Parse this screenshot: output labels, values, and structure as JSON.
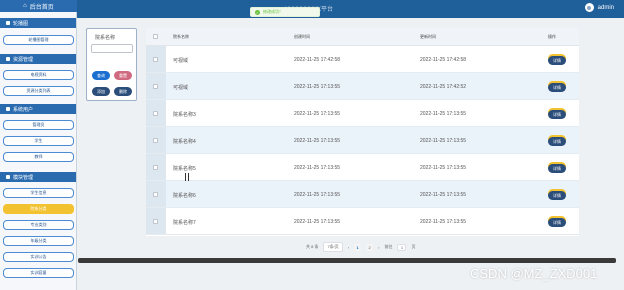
{
  "header": {
    "home_label": "后台首页",
    "title": "XXXXXXXXX平台",
    "user": "admin",
    "toast": "修改成功！"
  },
  "sidebar": {
    "groups": [
      {
        "title": "轮播图",
        "items": [
          "轮播图管理"
        ]
      },
      {
        "title": "资源管理",
        "items": [
          "电视资料",
          "资源分类列表"
        ]
      },
      {
        "title": "系统用户",
        "items": [
          "管理员",
          "学生",
          "教师"
        ]
      },
      {
        "title": "模块管理",
        "items": [
          "学生信息",
          "院系分类",
          "专业类别",
          "年级分类",
          "实训公告",
          "实训容量"
        ]
      }
    ]
  },
  "filter": {
    "label": "院系名称",
    "input_value": "",
    "buttons": {
      "search": "查询",
      "reset": "重置",
      "add": "添加",
      "delete": "删除"
    }
  },
  "table": {
    "headers": [
      "院系名称",
      "创建时间",
      "更新时间",
      "操作"
    ],
    "rows": [
      {
        "name": "可视域",
        "created": "2022-11-25 17:42:58",
        "updated": "2022-11-25 17:42:58",
        "action": "详情"
      },
      {
        "name": "可视域",
        "created": "2022-11-25 17:13:55",
        "updated": "2022-11-25 17:42:52",
        "action": "详情"
      },
      {
        "name": "院系名称3",
        "created": "2022-11-25 17:13:55",
        "updated": "2022-11-25 17:13:55",
        "action": "详情"
      },
      {
        "name": "院系名称4",
        "created": "2022-11-25 17:13:55",
        "updated": "2022-11-25 17:13:55",
        "action": "详情"
      },
      {
        "name": "院系名称5",
        "created": "2022-11-25 17:13:55",
        "updated": "2022-11-25 17:13:55",
        "action": "详情"
      },
      {
        "name": "院系名称6",
        "created": "2022-11-25 17:13:55",
        "updated": "2022-11-25 17:13:55",
        "action": "详情"
      },
      {
        "name": "院系名称7",
        "created": "2022-11-25 17:13:55",
        "updated": "2022-11-25 17:13:55",
        "action": "详情"
      }
    ]
  },
  "pager": {
    "total": "共 8 条",
    "page_size": "7条/页",
    "prev": "‹",
    "pages": [
      "1",
      "2"
    ],
    "next": "›",
    "goto_label": "前往",
    "goto_value": "1",
    "goto_suffix": "页"
  },
  "watermark": "CSDN @MZ_ZXD001"
}
